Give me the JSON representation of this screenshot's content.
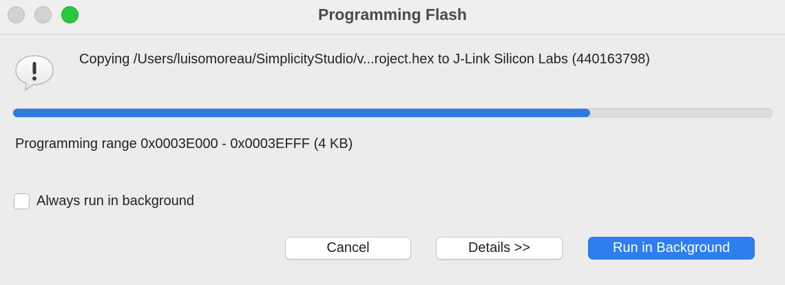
{
  "window": {
    "title": "Programming Flash"
  },
  "dialog": {
    "icon": "alert-speech-bubble-icon",
    "message": "Copying /Users/luisomoreau/SimplicityStudio/v...roject.hex to J-Link Silicon Labs (440163798)",
    "progress_fraction": 0.76,
    "status": "Programming range 0x0003E000 - 0x0003EFFF (4 KB)",
    "checkbox": {
      "label": "Always run in background",
      "checked": false
    },
    "buttons": {
      "cancel": "Cancel",
      "details": "Details >>",
      "run_in_background": "Run in Background"
    }
  },
  "colors": {
    "accent": "#2d7ff0",
    "progress": "#2f7ae0",
    "zoom": "#28c840"
  }
}
